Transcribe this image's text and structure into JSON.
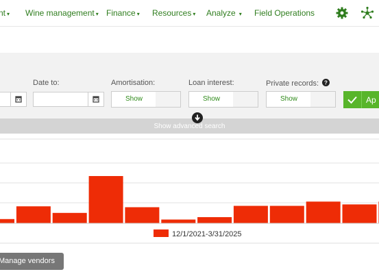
{
  "nav": {
    "items": [
      {
        "label": "nt",
        "caret": "▾"
      },
      {
        "label": "Wine management",
        "caret": "▾"
      },
      {
        "label": "Finance",
        "caret": "▾"
      },
      {
        "label": "Resources",
        "caret": "▾"
      },
      {
        "label": "Analyze",
        "caret": "▾"
      },
      {
        "label": "Field Operations",
        "caret": ""
      }
    ],
    "icons": [
      "gear-icon",
      "network-icon"
    ],
    "accent": "#2f7d1e"
  },
  "filters": {
    "date_to_label": "Date to:",
    "amortisation_label": "Amortisation:",
    "amortisation_value": "Show",
    "loan_interest_label": "Loan interest:",
    "loan_interest_value": "Show",
    "private_records_label": "Private records:",
    "private_records_value": "Show",
    "apply_label": "Ap",
    "advanced_search_label": "Show advanced search"
  },
  "chart_data": {
    "type": "bar",
    "legend": [
      "12/1/2021-3/31/2025"
    ],
    "legend_placement": "bottom-center",
    "grid": true,
    "color": "#ee2c06",
    "ylim": [
      0,
      100
    ],
    "series": [
      {
        "values": [
          9,
          36,
          22,
          100,
          34,
          8,
          13,
          37,
          37,
          46,
          40,
          46
        ]
      }
    ]
  },
  "actions": {
    "manage_vendors_label": "Manage vendors"
  }
}
